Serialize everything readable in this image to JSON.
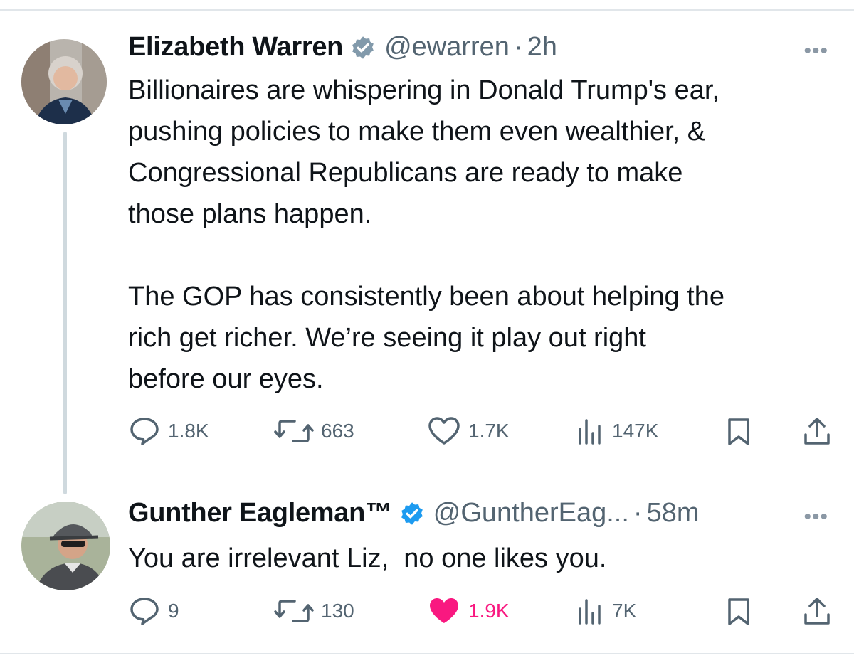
{
  "tweets": [
    {
      "author": "Elizabeth Warren",
      "handle": "@ewarren",
      "sep": "·",
      "time": "2h",
      "more": "•••",
      "text": "Billionaires are whispering in Donald Trump's ear,\npushing policies to make them even wealthier, &\nCongressional Republicans are ready to make\nthose plans happen.\n\nThe GOP has consistently been about helping the\nrich get richer. We’re seeing it play out right\nbefore our eyes.",
      "replies": "1.8K",
      "reposts": "663",
      "likes": "1.7K",
      "views": "147K",
      "liked": false,
      "verified_color": "#829aab"
    },
    {
      "author": "Gunther Eagleman™",
      "handle": "@GuntherEag...",
      "sep": "·",
      "time": "58m",
      "more": "•••",
      "text": "You are irrelevant Liz,  no one likes you.",
      "replies": "9",
      "reposts": "130",
      "likes": "1.9K",
      "views": "7K",
      "liked": true,
      "verified_color": "#1d9bf0"
    }
  ],
  "colors": {
    "like_active": "#f91880",
    "muted": "#536471"
  },
  "icons": [
    "reply-icon",
    "repost-icon",
    "like-icon",
    "views-icon",
    "bookmark-icon",
    "share-icon",
    "verified-badge-icon",
    "more-icon"
  ]
}
